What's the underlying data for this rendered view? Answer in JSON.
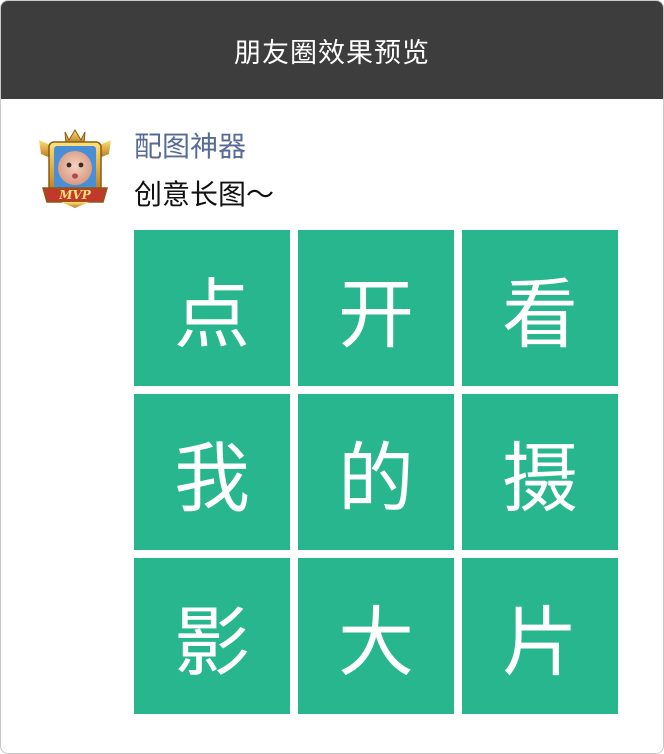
{
  "window": {
    "title": "朋友圈效果预览"
  },
  "post": {
    "username": "配图神器",
    "caption": "创意长图～",
    "avatar_badge": "MVP",
    "grid": [
      "点",
      "开",
      "看",
      "我",
      "的",
      "摄",
      "影",
      "大",
      "片"
    ]
  },
  "colors": {
    "titlebar": "#3d3d3d",
    "username": "#576b95",
    "tile": "#27b68d"
  }
}
